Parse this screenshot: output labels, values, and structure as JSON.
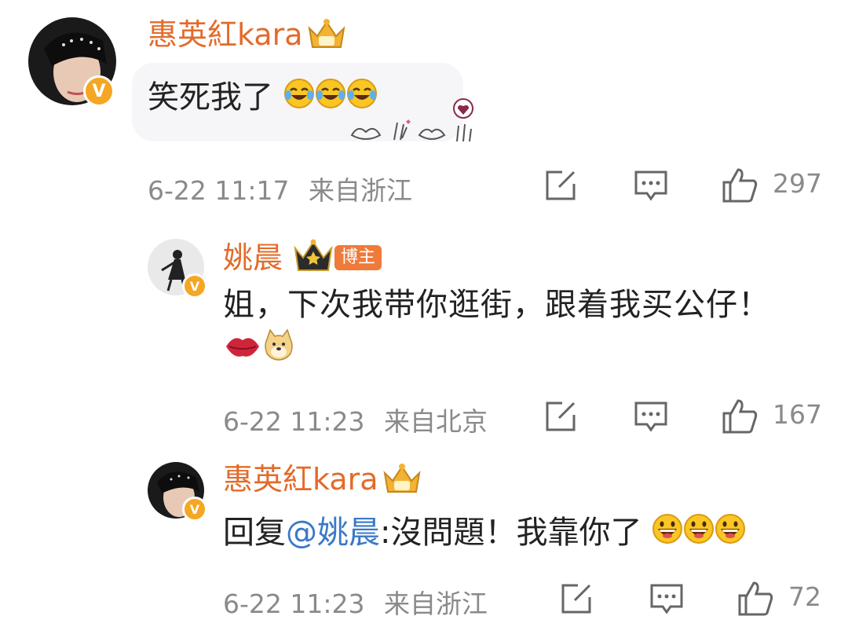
{
  "comments": [
    {
      "username": "惠英紅kara",
      "text": "笑死我了",
      "date": "6-22 11:17",
      "location": "来自浙江",
      "likes": "297",
      "verified_badge": "V",
      "crown_icon": "crown-badge-icon"
    },
    {
      "username": "姚晨",
      "host_label": "博主",
      "text": "姐，下次我带你逛街，跟着我买公仔！",
      "date": "6-22 11:23",
      "location": "来自北京",
      "likes": "167",
      "verified_badge": "V"
    },
    {
      "username": "惠英紅kara",
      "reply_prefix": "回复",
      "mention": "@姚晨",
      "text": ":沒問題！我靠你了",
      "date": "6-22 11:23",
      "location": "来自浙江",
      "likes": "72",
      "verified_badge": "V"
    }
  ],
  "colors": {
    "username": "#e36b2a",
    "meta": "#8a8a8a",
    "mention": "#3a78c8",
    "bubble": "#f6f6f8",
    "verified": "#f5a623"
  },
  "icons": [
    "edit-icon",
    "comment-icon",
    "thumbs-up-icon",
    "laugh-cry-emoji",
    "lips-emoji",
    "doge-emoji",
    "grin-emoji",
    "heart-hands-sticker"
  ]
}
